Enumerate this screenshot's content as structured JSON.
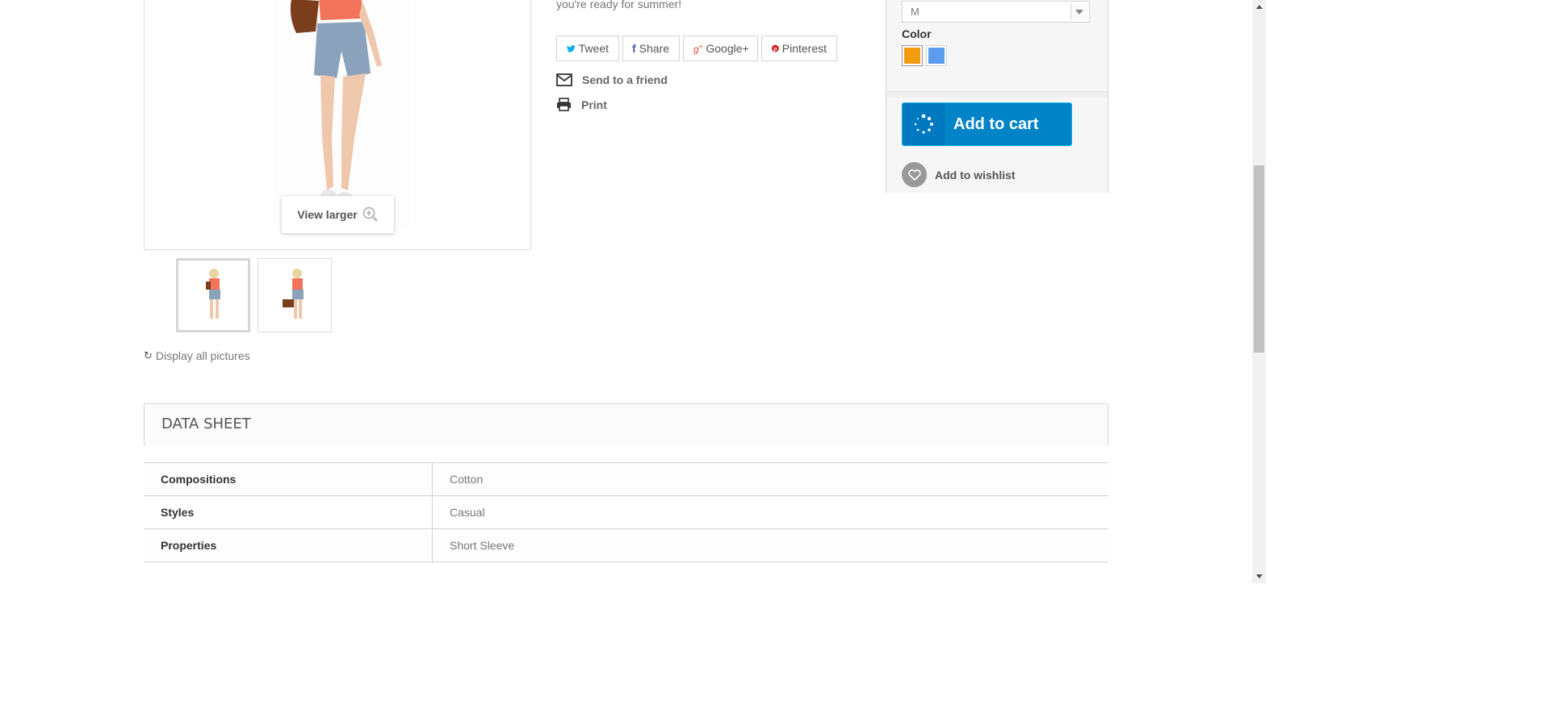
{
  "product": {
    "description_tail": "you're ready for summer!",
    "view_larger": "View larger",
    "display_all": "Display all pictures"
  },
  "social": {
    "tweet": "Tweet",
    "share": "Share",
    "google": "Google+",
    "pinterest": "Pinterest"
  },
  "links": {
    "send_friend": "Send to a friend",
    "print": "Print"
  },
  "buy": {
    "size_value": "M",
    "color_label": "Color",
    "colors": [
      "#f39c11",
      "#5d9cec"
    ],
    "add_to_cart": "Add to cart",
    "add_to_wishlist": "Add to wishlist"
  },
  "datasheet": {
    "title": "DATA SHEET",
    "rows": [
      {
        "key": "Compositions",
        "value": "Cotton"
      },
      {
        "key": "Styles",
        "value": "Casual"
      },
      {
        "key": "Properties",
        "value": "Short Sleeve"
      }
    ]
  }
}
